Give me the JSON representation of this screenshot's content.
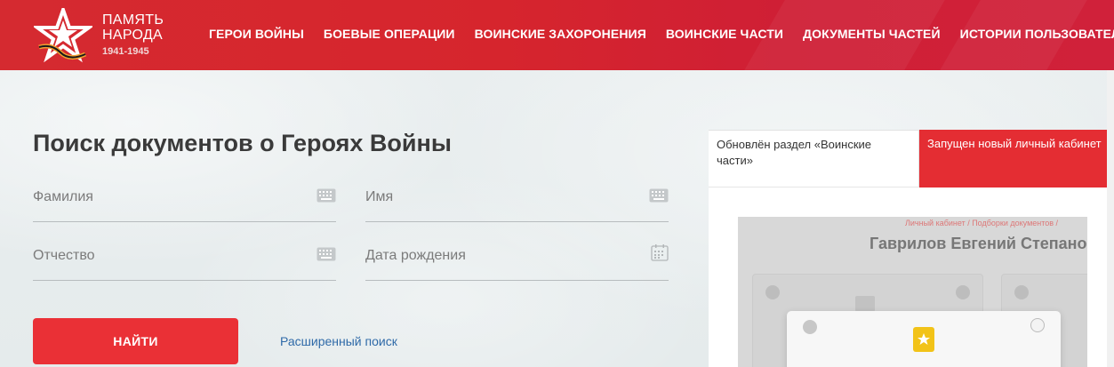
{
  "logo": {
    "line1": "ПАМЯТЬ",
    "line2": "НАРОДА",
    "years": "1941-1945"
  },
  "nav": [
    {
      "label": "ГЕРОИ ВОЙНЫ"
    },
    {
      "label": "БОЕВЫЕ ОПЕРАЦИИ"
    },
    {
      "label": "ВОИНСКИЕ ЗАХОРОНЕНИЯ"
    },
    {
      "label": "ВОИНСКИЕ ЧАСТИ"
    },
    {
      "label": "ДОКУМЕНТЫ ЧАСТЕЙ"
    },
    {
      "label": "ИСТОРИИ ПОЛЬЗОВАТЕЛЕЙ"
    }
  ],
  "search": {
    "title": "Поиск документов о Героях Войны",
    "surname_placeholder": "Фамилия",
    "name_placeholder": "Имя",
    "patronymic_placeholder": "Отчество",
    "birthdate_placeholder": "Дата рождения",
    "find_label": "НАЙТИ",
    "advanced_label": "Расширенный поиск"
  },
  "news": {
    "tab1": "Обновлён раздел «Воинские части»",
    "tab2": "Запущен новый личный кабинет",
    "preview_breadcrumb": "Личный кабинет / Подборки документов /",
    "preview_name": "Гаврилов Евгений Степанов"
  },
  "colors": {
    "header_red": "#d52a30",
    "button_red": "#ea3036",
    "link_blue": "#2f6aa8"
  },
  "icons": {
    "surname": "keyboard-icon",
    "name": "keyboard-icon",
    "patronymic": "keyboard-icon",
    "birthdate": "calendar-icon"
  }
}
